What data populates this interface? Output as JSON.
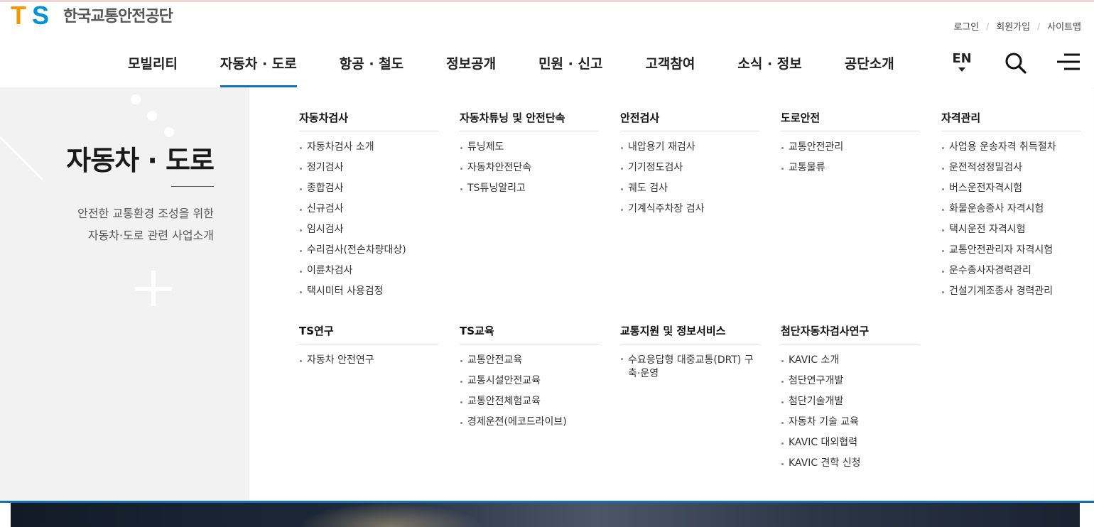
{
  "header": {
    "logo_text": "한국교통안전공단",
    "logo_mark_t": "T",
    "logo_mark_s": "S",
    "util_links": [
      "로그인",
      "회원가입",
      "사이트맵"
    ],
    "util_separator": "/",
    "lang": "EN"
  },
  "gnb": [
    "모빌리티",
    "자동차 · 도로",
    "항공 · 철도",
    "정보공개",
    "민원 · 신고",
    "고객참여",
    "소식 · 정보",
    "공단소개"
  ],
  "gnb_active_index": 1,
  "side": {
    "title": "자동차 · 도로",
    "desc_line1": "안전한 교통환경 조성을 위한",
    "desc_line2": "자동차·도로 관련 사업소개"
  },
  "menu": {
    "col1": {
      "title": "자동차검사",
      "items": [
        "자동차검사 소개",
        "정기검사",
        "종합검사",
        "신규검사",
        "임시검사",
        "수리검사(전손차량대상)",
        "이륜차검사",
        "택시미터 사용검정"
      ]
    },
    "col2": {
      "title": "자동차튜닝 및 안전단속",
      "items": [
        "튜닝제도",
        "자동차안전단속",
        "TS튜닝알리고"
      ]
    },
    "col3": {
      "title": "안전검사",
      "items": [
        "내압용기 재검사",
        "기기정도검사",
        "궤도 검사",
        "기계식주차장 검사"
      ]
    },
    "col4": {
      "title": "도로안전",
      "items": [
        "교통안전관리",
        "교통물류"
      ]
    },
    "col5": {
      "title": "자격관리",
      "items": [
        "사업용 운송자격 취득절차",
        "운전적성정밀검사",
        "버스운전자격시험",
        "화물운송종사 자격시험",
        "택시운전 자격시험",
        "교통안전관리자 자격시험",
        "운수종사자경력관리",
        "건설기계조종사 경력관리"
      ]
    },
    "col6": {
      "title": "TS연구",
      "items": [
        "자동차 안전연구"
      ]
    },
    "col7": {
      "title": "TS교육",
      "items": [
        "교통안전교육",
        "교통시설안전교육",
        "교통안전체험교육",
        "경제운전(에코드라이브)"
      ]
    },
    "col8": {
      "title": "교통지원 및 정보서비스",
      "items": [
        "수요응답형 대중교통(DRT) 구축·운영"
      ]
    },
    "col9": {
      "title": "첨단자동차검사연구",
      "items": [
        "KAVIC 소개",
        "첨단연구개발",
        "첨단기술개발",
        "자동차 기술 교육",
        "KAVIC 대외협력",
        "KAVIC 견학 신청"
      ]
    }
  },
  "colors": {
    "accent": "#1071b7",
    "logo_orange": "#f39800",
    "logo_blue": "#0093d5",
    "side_bg": "#f2f2f2"
  },
  "icons": [
    "search-icon",
    "menu-icon",
    "caret-down-icon"
  ]
}
